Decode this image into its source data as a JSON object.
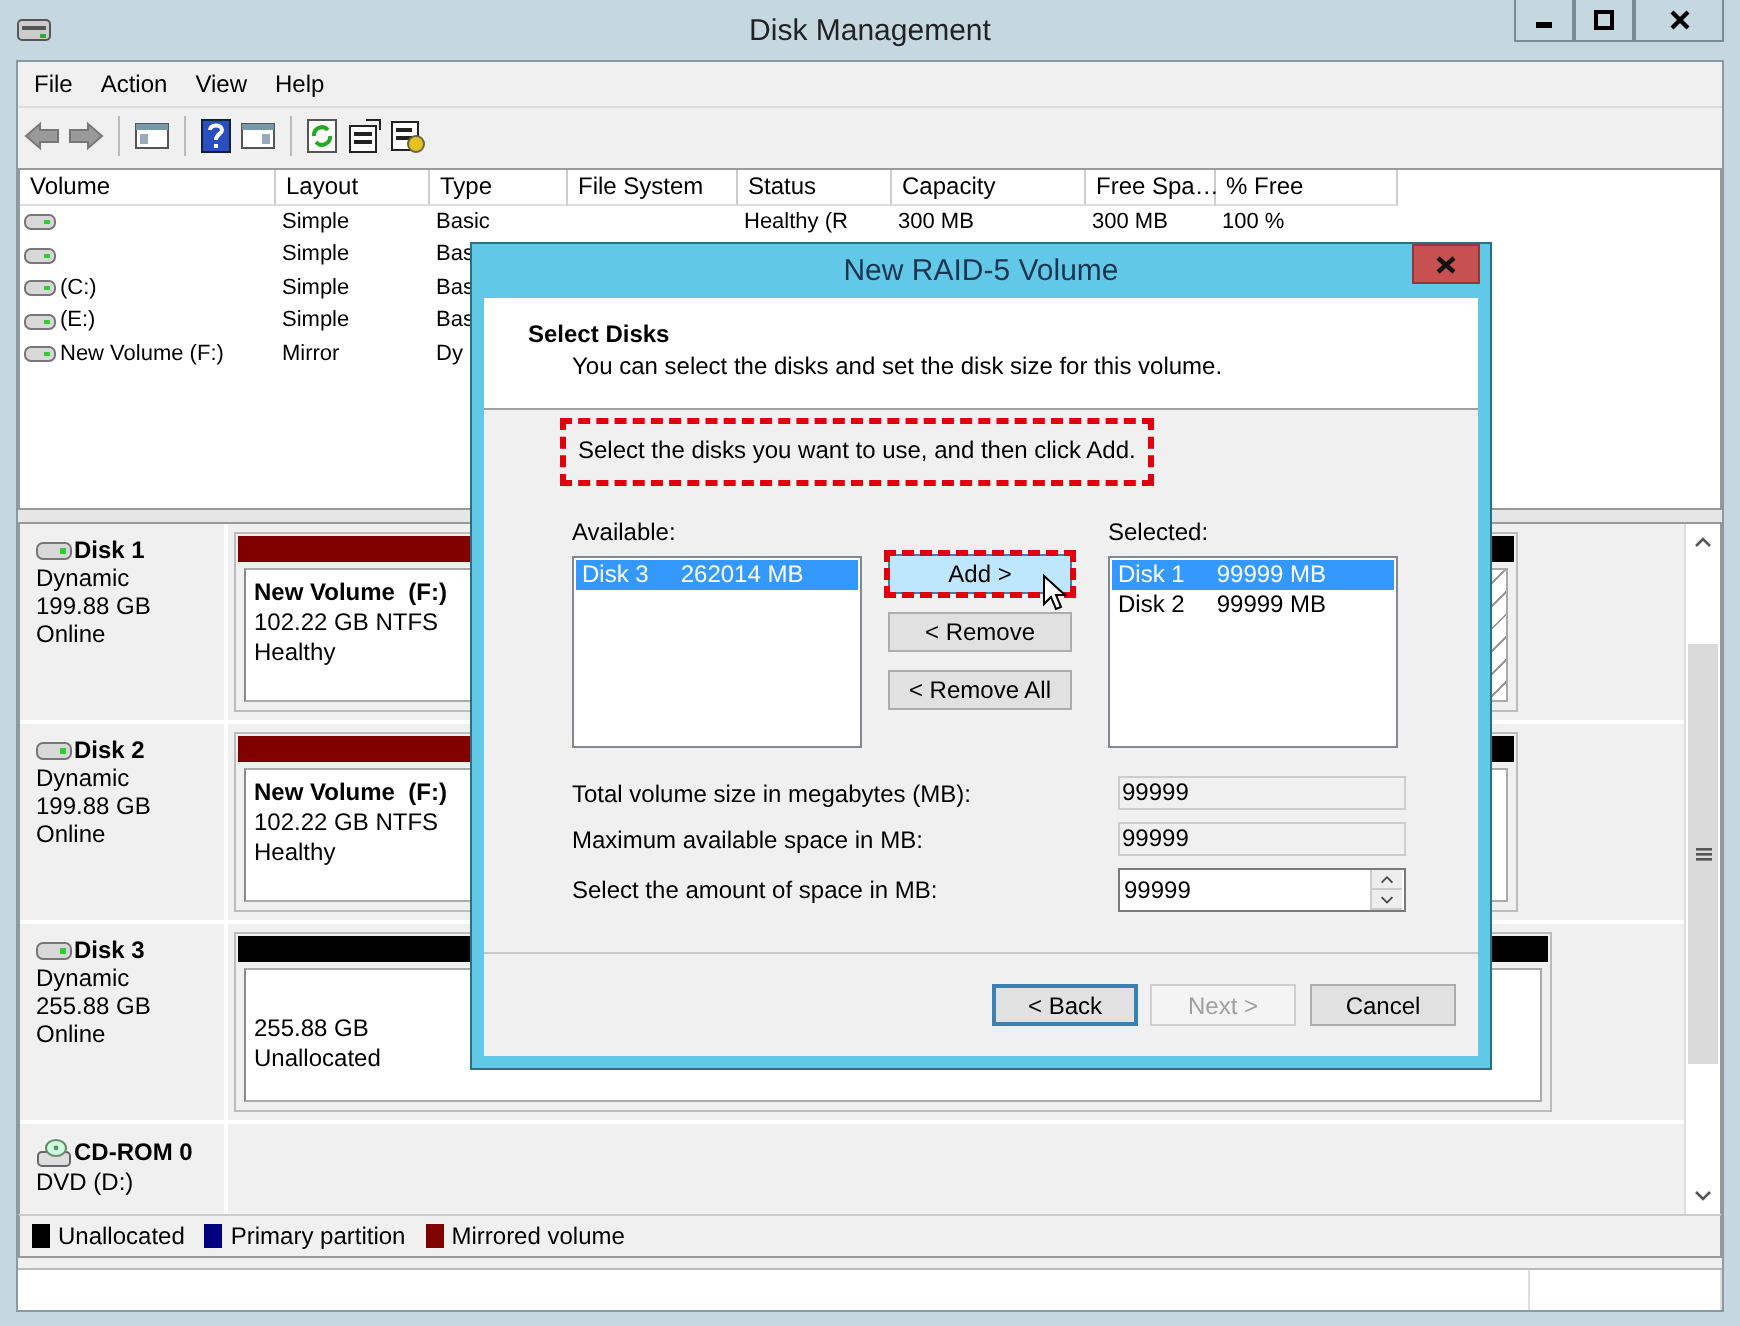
{
  "window": {
    "title": "Disk Management"
  },
  "menu": [
    {
      "label": "File"
    },
    {
      "label": "Action"
    },
    {
      "label": "View"
    },
    {
      "label": "Help"
    }
  ],
  "volumes": {
    "columns": [
      "Volume",
      "Layout",
      "Type",
      "File System",
      "Status",
      "Capacity",
      "Free Spa…",
      "% Free"
    ],
    "rows": [
      {
        "layout": "Simple",
        "type": "Basic",
        "status": "Healthy (R",
        "capacity": "300 MB",
        "free_space": "300 MB",
        "percent_free": "100 %"
      },
      {
        "layout": "Simple",
        "type": "Bas"
      },
      {
        "volume": "(C:)",
        "layout": "Simple",
        "type": "Bas"
      },
      {
        "volume": "(E:)",
        "layout": "Simple",
        "type": "Bas"
      },
      {
        "volume": "New Volume (F:)",
        "layout": "Mirror",
        "type": "Dy"
      }
    ]
  },
  "disks": [
    {
      "kind": "disk",
      "name": "Disk 1",
      "lines": [
        "Dynamic",
        "199.88 GB",
        "Online"
      ],
      "partitions": [
        {
          "kind": "mirrored",
          "title": "New Volume  (F:)",
          "lines": [
            "102.22 GB NTFS",
            "Healthy"
          ],
          "selected": false
        },
        {
          "kind": "unallocated",
          "selected": true
        }
      ]
    },
    {
      "kind": "disk",
      "name": "Disk 2",
      "lines": [
        "Dynamic",
        "199.88 GB",
        "Online"
      ],
      "partitions": [
        {
          "kind": "mirrored",
          "title": "New Volume  (F:)",
          "lines": [
            "102.22 GB NTFS",
            "Healthy"
          ],
          "selected": false
        },
        {
          "kind": "unallocated",
          "selected": false
        }
      ]
    },
    {
      "kind": "disk",
      "name": "Disk 3",
      "lines": [
        "Dynamic",
        "255.88 GB",
        "Online"
      ],
      "partitions": [
        {
          "kind": "unallocated",
          "lines": [
            "255.88 GB",
            "Unallocated"
          ],
          "selected": false
        }
      ]
    },
    {
      "kind": "cdrom",
      "name": "CD-ROM 0",
      "lines": [
        "DVD (D:)"
      ]
    }
  ],
  "legend": [
    {
      "label": "Unallocated",
      "color": "#000000"
    },
    {
      "label": "Primary partition",
      "color": "#000080"
    },
    {
      "label": "Mirrored volume",
      "color": "#800000"
    }
  ],
  "dialog": {
    "title": "New RAID-5 Volume",
    "heading": "Select Disks",
    "subheading": "You can select the disks and set the disk size for this volume.",
    "instruction": {
      "text": "Select the disks you want to use, and then click Add.",
      "highlighted": true
    },
    "available": {
      "label": "Available:",
      "items": [
        {
          "disk": "Disk 3",
          "size": "262014 MB",
          "selected": true
        }
      ]
    },
    "transfer_buttons": [
      {
        "label": "Add >",
        "highlighted": true,
        "hovered": true
      },
      {
        "label": "< Remove",
        "highlighted": false,
        "hovered": false
      },
      {
        "label": "< Remove All",
        "highlighted": false,
        "hovered": false
      }
    ],
    "selected": {
      "label": "Selected:",
      "items": [
        {
          "disk": "Disk 1",
          "size": "99999 MB",
          "selected": true
        },
        {
          "disk": "Disk 2",
          "size": "99999 MB",
          "selected": false
        }
      ]
    },
    "fields": [
      {
        "kind": "readonly",
        "label": "Total volume size in megabytes (MB):",
        "value": "99999"
      },
      {
        "kind": "readonly",
        "label": "Maximum available space in MB:",
        "value": "99999"
      },
      {
        "kind": "spin",
        "label": "Select the amount of space in MB:",
        "value": "99999"
      }
    ],
    "buttons": [
      {
        "label": "< Back",
        "disabled": false,
        "focused": true
      },
      {
        "label": "Next >",
        "disabled": true,
        "focused": false
      },
      {
        "label": "Cancel",
        "disabled": false,
        "focused": false
      }
    ]
  }
}
